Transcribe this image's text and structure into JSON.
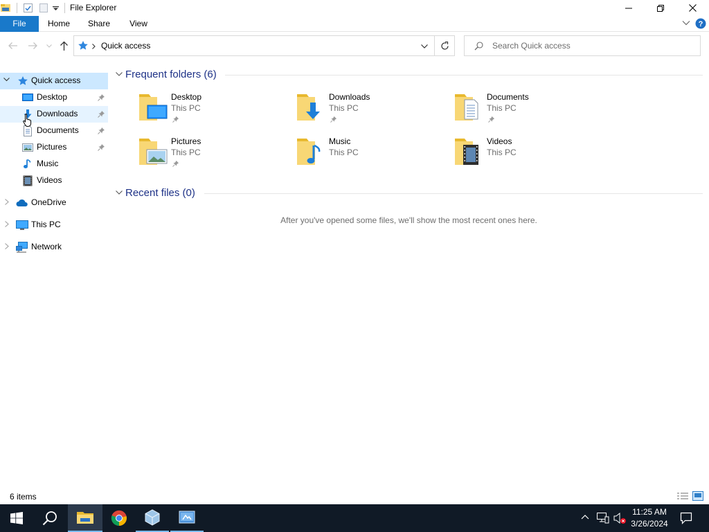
{
  "window": {
    "title": "File Explorer"
  },
  "ribbon": {
    "tabs": [
      {
        "label": "File"
      },
      {
        "label": "Home"
      },
      {
        "label": "Share"
      },
      {
        "label": "View"
      }
    ]
  },
  "address": {
    "path": "Quick access",
    "icon": "quick-access-star-icon"
  },
  "search": {
    "placeholder": "Search Quick access"
  },
  "sidebar": {
    "quick_access": {
      "label": "Quick access",
      "expanded": true
    },
    "pinned": [
      {
        "label": "Desktop",
        "icon": "desktop-icon",
        "pinned": true
      },
      {
        "label": "Downloads",
        "icon": "downloads-icon",
        "pinned": true
      },
      {
        "label": "Documents",
        "icon": "documents-icon",
        "pinned": true
      },
      {
        "label": "Pictures",
        "icon": "pictures-icon",
        "pinned": true
      },
      {
        "label": "Music",
        "icon": "music-icon",
        "pinned": false
      },
      {
        "label": "Videos",
        "icon": "videos-icon",
        "pinned": false
      }
    ],
    "roots": [
      {
        "label": "OneDrive",
        "icon": "onedrive-icon"
      },
      {
        "label": "This PC",
        "icon": "this-pc-icon"
      },
      {
        "label": "Network",
        "icon": "network-icon"
      }
    ]
  },
  "frequent": {
    "header": "Frequent folders (6)",
    "folders": [
      {
        "name": "Desktop",
        "location": "This PC",
        "pinned": true,
        "icon": "desktop-folder-icon"
      },
      {
        "name": "Downloads",
        "location": "This PC",
        "pinned": true,
        "icon": "downloads-folder-icon"
      },
      {
        "name": "Documents",
        "location": "This PC",
        "pinned": true,
        "icon": "documents-folder-icon"
      },
      {
        "name": "Pictures",
        "location": "This PC",
        "pinned": true,
        "icon": "pictures-folder-icon"
      },
      {
        "name": "Music",
        "location": "This PC",
        "pinned": false,
        "icon": "music-folder-icon"
      },
      {
        "name": "Videos",
        "location": "This PC",
        "pinned": false,
        "icon": "videos-folder-icon"
      }
    ]
  },
  "recent": {
    "header": "Recent files (0)",
    "empty_message": "After you've opened some files, we'll show the most recent ones here."
  },
  "status": {
    "item_count": "6 items"
  },
  "taskbar": {
    "apps": [
      "start-icon",
      "search-icon",
      "file-explorer-icon",
      "chrome-icon",
      "virtualbox-icon",
      "control-panel-app-icon"
    ],
    "time": "11:25 AM",
    "date": "3/26/2024"
  },
  "colors": {
    "accent": "#1979ca",
    "header_text": "#1e3287",
    "taskbar": "#101a26",
    "folder": "#f8d775"
  }
}
